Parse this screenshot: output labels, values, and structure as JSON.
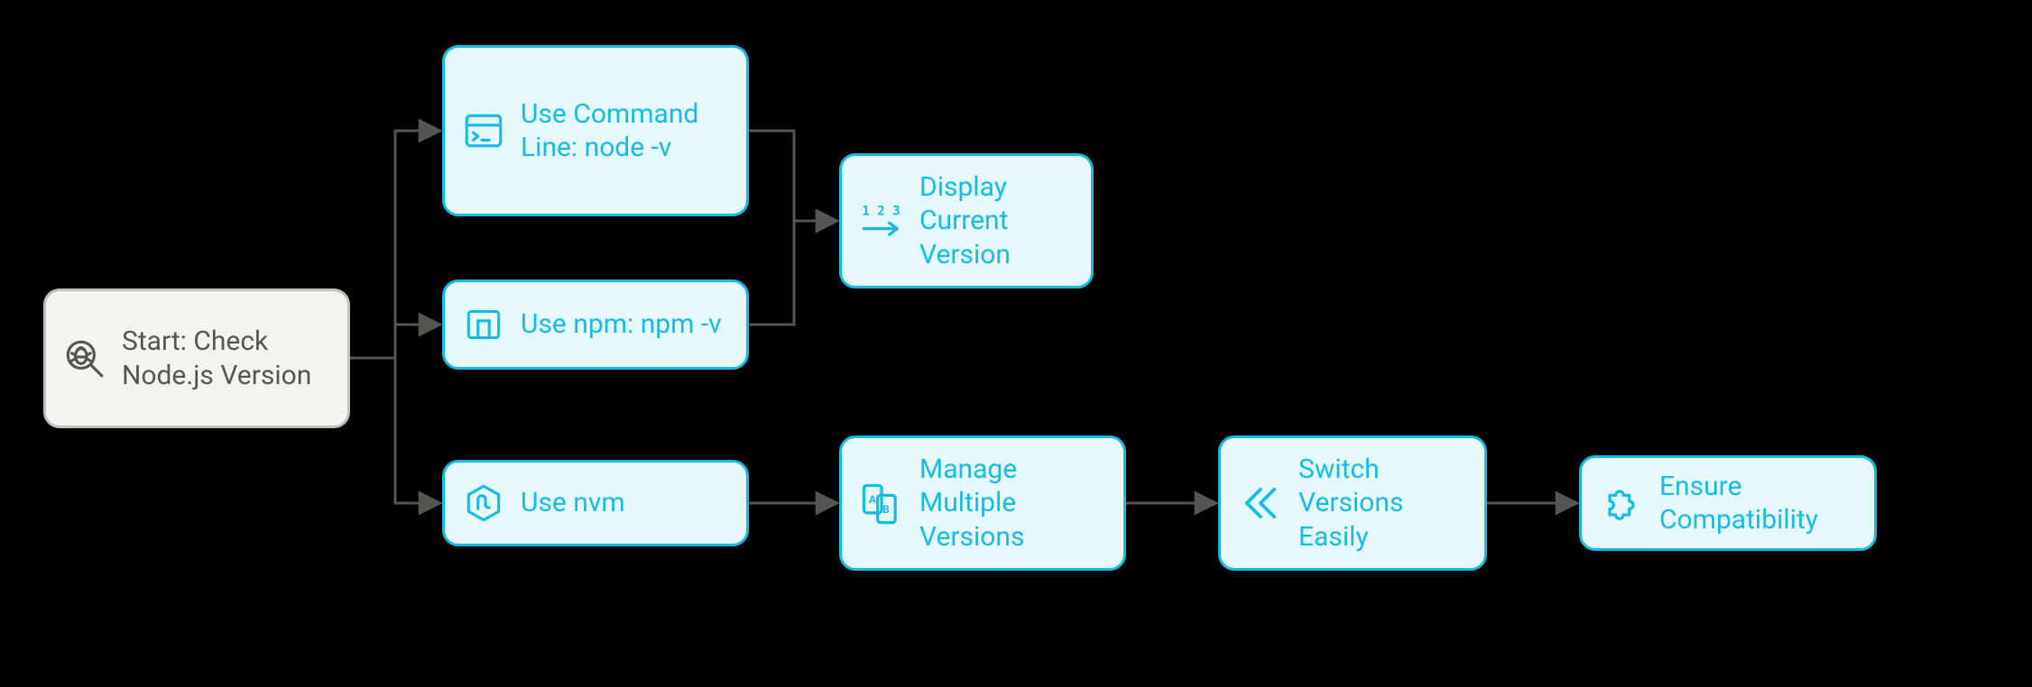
{
  "colors": {
    "node_start_bg": "#f3f3f2",
    "node_start_border": "#bfbfbd",
    "node_start_text": "#555654",
    "node_step_bg": "#E6F9FF",
    "node_step_border": "#16BBE2",
    "node_step_text": "#16BBE2",
    "edge": "#555654"
  },
  "nodes": {
    "start": {
      "label": "Start: Check Node.js Version",
      "icon": "bug-magnify-icon"
    },
    "cmd": {
      "label": "Use Command Line: node -v",
      "icon": "terminal-icon"
    },
    "npm": {
      "label": "Use npm: npm -v",
      "icon": "npm-icon"
    },
    "nvm": {
      "label": "Use nvm",
      "icon": "nodejs-icon"
    },
    "display": {
      "label": "Display Current Version",
      "icon": "number-arrow-icon"
    },
    "manage": {
      "label": "Manage Multiple Versions",
      "icon": "devices-ab-icon"
    },
    "switch": {
      "label": "Switch Versions Easily",
      "icon": "double-chevron-left-icon"
    },
    "compat": {
      "label": "Ensure Compatibility",
      "icon": "puzzle-icon"
    }
  },
  "edges": [
    {
      "from": "start",
      "to": "cmd"
    },
    {
      "from": "start",
      "to": "npm"
    },
    {
      "from": "start",
      "to": "nvm"
    },
    {
      "from": "cmd",
      "to": "display"
    },
    {
      "from": "npm",
      "to": "display"
    },
    {
      "from": "nvm",
      "to": "manage"
    },
    {
      "from": "manage",
      "to": "switch"
    },
    {
      "from": "switch",
      "to": "compat"
    }
  ]
}
